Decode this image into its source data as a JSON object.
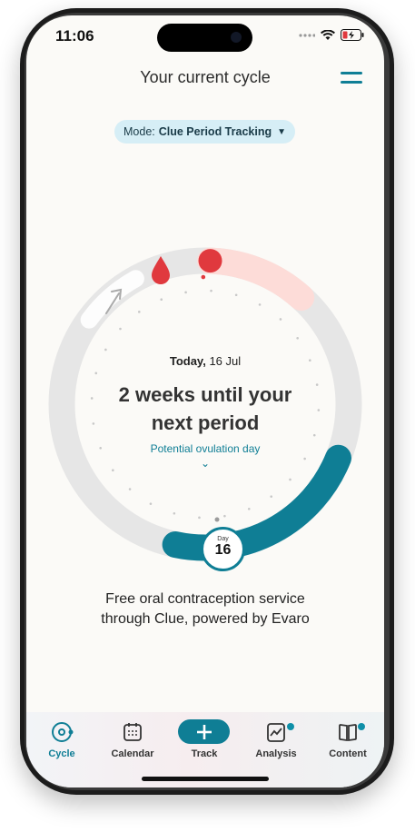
{
  "status_bar": {
    "time": "11:06"
  },
  "header": {
    "title": "Your current cycle"
  },
  "mode": {
    "prefix": "Mode:",
    "value": "Clue Period Tracking"
  },
  "cycle": {
    "today_label": "Today,",
    "date": "16 Jul",
    "headline_line1": "2 weeks until your",
    "headline_line2": "next period",
    "ovulation_link": "Potential ovulation day",
    "day_label": "Day",
    "day_number": "16"
  },
  "promo": {
    "line1": "Free oral contraception service",
    "line2": "through Clue, powered by Evaro"
  },
  "tabs": [
    {
      "label": "Cycle",
      "icon": "cycle-icon",
      "active": true
    },
    {
      "label": "Calendar",
      "icon": "calendar-icon"
    },
    {
      "label": "Track",
      "icon": "plus-icon"
    },
    {
      "label": "Analysis",
      "icon": "analysis-icon",
      "badge": true
    },
    {
      "label": "Content",
      "icon": "book-icon",
      "badge": true
    }
  ],
  "colors": {
    "accent": "#0f7e95",
    "period": "#e0393e",
    "period_light": "#fddcd8",
    "ring_bg": "#e6e6e6",
    "background": "#fbfaf7"
  }
}
